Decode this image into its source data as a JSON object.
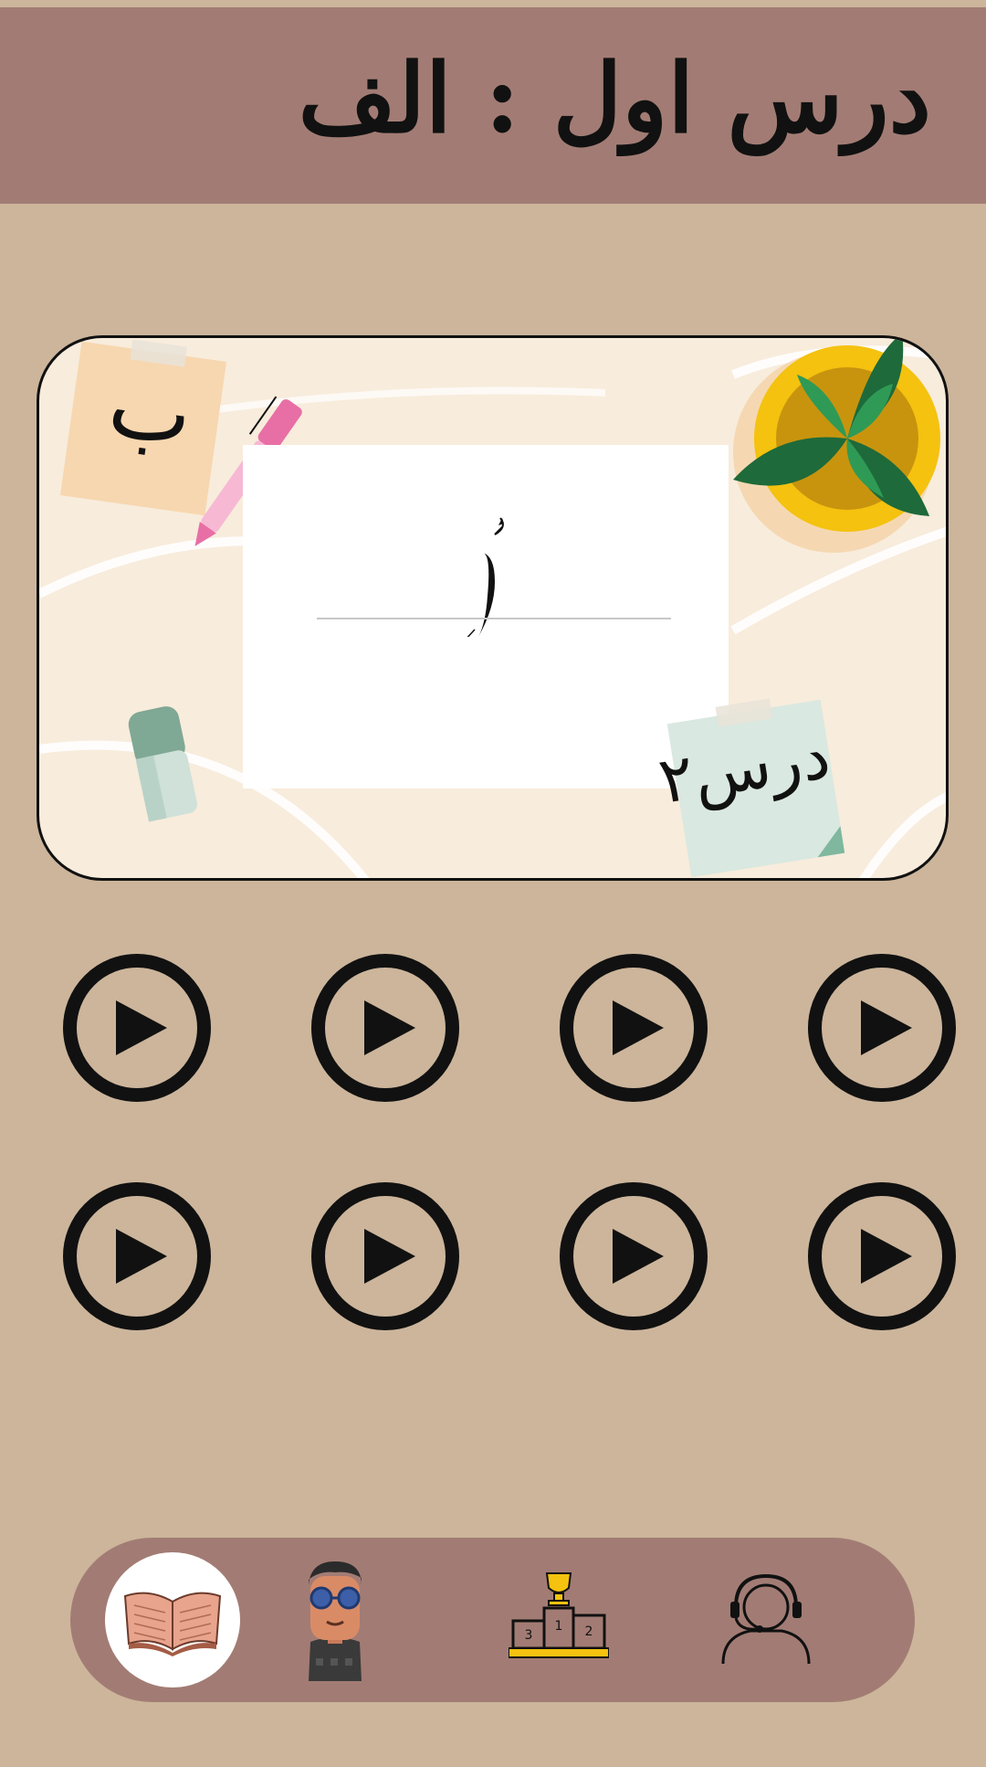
{
  "header": {
    "title": "درس اول : الف"
  },
  "lesson_card": {
    "note_b_text": "ب",
    "note_dars_text": "درس۲",
    "guide_letter": "أ"
  },
  "play_buttons": [
    {
      "index": 1
    },
    {
      "index": 2
    },
    {
      "index": 3
    },
    {
      "index": 4
    },
    {
      "index": 5
    },
    {
      "index": 6
    },
    {
      "index": 7
    },
    {
      "index": 8
    }
  ],
  "bottom_nav": {
    "items": [
      {
        "icon": "book-icon",
        "active": true
      },
      {
        "icon": "avatar-icon",
        "active": false
      },
      {
        "icon": "podium-trophy-icon",
        "active": false
      },
      {
        "icon": "support-headset-icon",
        "active": false
      }
    ],
    "podium_labels": [
      "3",
      "1",
      "2"
    ]
  },
  "colors": {
    "background": "#ccb59b",
    "header": "#a27c74",
    "nav_bar": "#a27c74",
    "card": "#f8ecdc"
  }
}
